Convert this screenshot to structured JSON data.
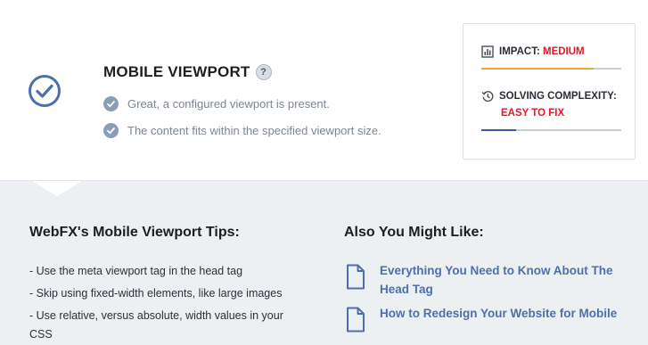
{
  "section": {
    "title": "MOBILE VIEWPORT",
    "help_label": "?",
    "status_icon": "check-circle-icon",
    "checks": [
      "Great, a configured viewport is present.",
      "The content fits within the specified viewport size."
    ]
  },
  "metrics": {
    "impact": {
      "label": "IMPACT:",
      "value": "MEDIUM",
      "level": 0.8,
      "color": "#f0a43a"
    },
    "complexity": {
      "label": "SOLVING COMPLEXITY:",
      "value": "EASY TO FIX",
      "level": 0.25,
      "color": "#3a5aa8"
    },
    "value_color": "#e0182a"
  },
  "tips": {
    "title": "WebFX's Mobile Viewport Tips:",
    "items": [
      "- Use the meta viewport tag in the head tag",
      "- Skip using fixed-width elements, like large images",
      "- Use relative, versus absolute, width values in your CSS"
    ]
  },
  "also": {
    "title": "Also You Might Like:",
    "links": [
      "Everything You Need to Know About The Head Tag",
      "How to Redesign Your Website for Mobile"
    ]
  }
}
